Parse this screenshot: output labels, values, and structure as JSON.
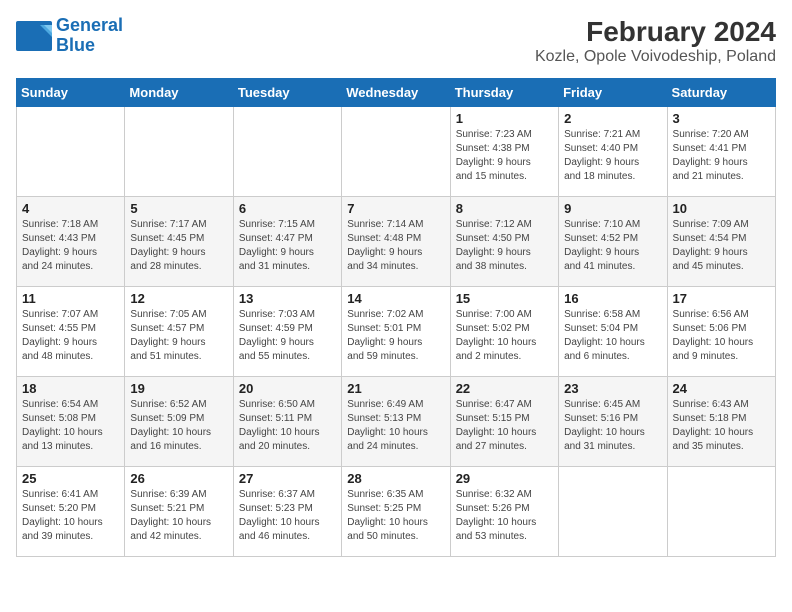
{
  "logo": {
    "line1": "General",
    "line2": "Blue"
  },
  "title": "February 2024",
  "subtitle": "Kozle, Opole Voivodeship, Poland",
  "headers": [
    "Sunday",
    "Monday",
    "Tuesday",
    "Wednesday",
    "Thursday",
    "Friday",
    "Saturday"
  ],
  "weeks": [
    [
      {
        "day": "",
        "info": ""
      },
      {
        "day": "",
        "info": ""
      },
      {
        "day": "",
        "info": ""
      },
      {
        "day": "",
        "info": ""
      },
      {
        "day": "1",
        "info": "Sunrise: 7:23 AM\nSunset: 4:38 PM\nDaylight: 9 hours\nand 15 minutes."
      },
      {
        "day": "2",
        "info": "Sunrise: 7:21 AM\nSunset: 4:40 PM\nDaylight: 9 hours\nand 18 minutes."
      },
      {
        "day": "3",
        "info": "Sunrise: 7:20 AM\nSunset: 4:41 PM\nDaylight: 9 hours\nand 21 minutes."
      }
    ],
    [
      {
        "day": "4",
        "info": "Sunrise: 7:18 AM\nSunset: 4:43 PM\nDaylight: 9 hours\nand 24 minutes."
      },
      {
        "day": "5",
        "info": "Sunrise: 7:17 AM\nSunset: 4:45 PM\nDaylight: 9 hours\nand 28 minutes."
      },
      {
        "day": "6",
        "info": "Sunrise: 7:15 AM\nSunset: 4:47 PM\nDaylight: 9 hours\nand 31 minutes."
      },
      {
        "day": "7",
        "info": "Sunrise: 7:14 AM\nSunset: 4:48 PM\nDaylight: 9 hours\nand 34 minutes."
      },
      {
        "day": "8",
        "info": "Sunrise: 7:12 AM\nSunset: 4:50 PM\nDaylight: 9 hours\nand 38 minutes."
      },
      {
        "day": "9",
        "info": "Sunrise: 7:10 AM\nSunset: 4:52 PM\nDaylight: 9 hours\nand 41 minutes."
      },
      {
        "day": "10",
        "info": "Sunrise: 7:09 AM\nSunset: 4:54 PM\nDaylight: 9 hours\nand 45 minutes."
      }
    ],
    [
      {
        "day": "11",
        "info": "Sunrise: 7:07 AM\nSunset: 4:55 PM\nDaylight: 9 hours\nand 48 minutes."
      },
      {
        "day": "12",
        "info": "Sunrise: 7:05 AM\nSunset: 4:57 PM\nDaylight: 9 hours\nand 51 minutes."
      },
      {
        "day": "13",
        "info": "Sunrise: 7:03 AM\nSunset: 4:59 PM\nDaylight: 9 hours\nand 55 minutes."
      },
      {
        "day": "14",
        "info": "Sunrise: 7:02 AM\nSunset: 5:01 PM\nDaylight: 9 hours\nand 59 minutes."
      },
      {
        "day": "15",
        "info": "Sunrise: 7:00 AM\nSunset: 5:02 PM\nDaylight: 10 hours\nand 2 minutes."
      },
      {
        "day": "16",
        "info": "Sunrise: 6:58 AM\nSunset: 5:04 PM\nDaylight: 10 hours\nand 6 minutes."
      },
      {
        "day": "17",
        "info": "Sunrise: 6:56 AM\nSunset: 5:06 PM\nDaylight: 10 hours\nand 9 minutes."
      }
    ],
    [
      {
        "day": "18",
        "info": "Sunrise: 6:54 AM\nSunset: 5:08 PM\nDaylight: 10 hours\nand 13 minutes."
      },
      {
        "day": "19",
        "info": "Sunrise: 6:52 AM\nSunset: 5:09 PM\nDaylight: 10 hours\nand 16 minutes."
      },
      {
        "day": "20",
        "info": "Sunrise: 6:50 AM\nSunset: 5:11 PM\nDaylight: 10 hours\nand 20 minutes."
      },
      {
        "day": "21",
        "info": "Sunrise: 6:49 AM\nSunset: 5:13 PM\nDaylight: 10 hours\nand 24 minutes."
      },
      {
        "day": "22",
        "info": "Sunrise: 6:47 AM\nSunset: 5:15 PM\nDaylight: 10 hours\nand 27 minutes."
      },
      {
        "day": "23",
        "info": "Sunrise: 6:45 AM\nSunset: 5:16 PM\nDaylight: 10 hours\nand 31 minutes."
      },
      {
        "day": "24",
        "info": "Sunrise: 6:43 AM\nSunset: 5:18 PM\nDaylight: 10 hours\nand 35 minutes."
      }
    ],
    [
      {
        "day": "25",
        "info": "Sunrise: 6:41 AM\nSunset: 5:20 PM\nDaylight: 10 hours\nand 39 minutes."
      },
      {
        "day": "26",
        "info": "Sunrise: 6:39 AM\nSunset: 5:21 PM\nDaylight: 10 hours\nand 42 minutes."
      },
      {
        "day": "27",
        "info": "Sunrise: 6:37 AM\nSunset: 5:23 PM\nDaylight: 10 hours\nand 46 minutes."
      },
      {
        "day": "28",
        "info": "Sunrise: 6:35 AM\nSunset: 5:25 PM\nDaylight: 10 hours\nand 50 minutes."
      },
      {
        "day": "29",
        "info": "Sunrise: 6:32 AM\nSunset: 5:26 PM\nDaylight: 10 hours\nand 53 minutes."
      },
      {
        "day": "",
        "info": ""
      },
      {
        "day": "",
        "info": ""
      }
    ]
  ]
}
